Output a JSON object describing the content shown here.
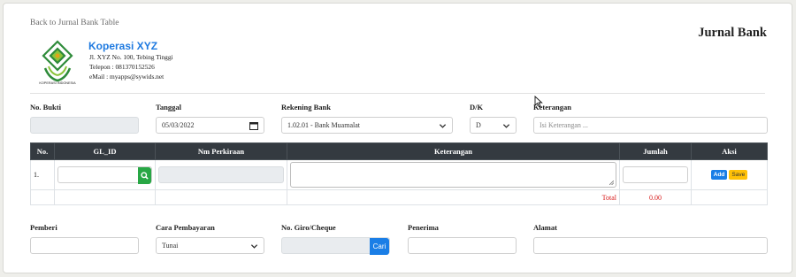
{
  "nav": {
    "back_link": "Back to Jurnal Bank Table"
  },
  "page_title": "Jurnal Bank",
  "org": {
    "name": "Koperasi XYZ",
    "address": "Jl. XYZ No. 100, Tebing Tinggi",
    "phone": "Telepon : 081370152526",
    "email": "eMail : myapps@sywids.net",
    "logo_caption": "KOPERASI INDONESIA"
  },
  "header_form": {
    "no_bukti": {
      "label": "No. Bukti",
      "value": ""
    },
    "tanggal": {
      "label": "Tanggal",
      "value": "05/03/2022"
    },
    "rekening": {
      "label": "Rekening Bank",
      "value": "1.02.01 - Bank Muamalat"
    },
    "dk": {
      "label": "D/K",
      "value": "D"
    },
    "keterangan": {
      "label": "Keterangan",
      "placeholder": "Isi Keterangan ..."
    }
  },
  "table": {
    "headers": [
      "No.",
      "GL_ID",
      "Nm Perkiraan",
      "Keterangan",
      "Jumlah",
      "Aksi"
    ],
    "row": {
      "no": "1.",
      "add_label": "Add",
      "save_label": "Save"
    },
    "total_label": "Total",
    "total_value": "0.00"
  },
  "footer_form": {
    "pemberi": {
      "label": "Pemberi",
      "value": ""
    },
    "cara_bayar": {
      "label": "Cara Pembayaran",
      "value": "Tunai"
    },
    "giro": {
      "label": "No. Giro/Cheque",
      "button": "Cari"
    },
    "penerima": {
      "label": "Penerima",
      "value": ""
    },
    "alamat": {
      "label": "Alamat",
      "value": ""
    }
  },
  "colors": {
    "accent": "#1f7ae0",
    "table_header": "#343a40",
    "search_button": "#28a745",
    "save_button": "#ffc107",
    "total_text": "#d71a1a",
    "logo_green": "#2e8b3a"
  },
  "icons": [
    "logo-emblem",
    "calendar-icon",
    "chevron-down-icon",
    "search-icon",
    "mouse-cursor-icon"
  ]
}
